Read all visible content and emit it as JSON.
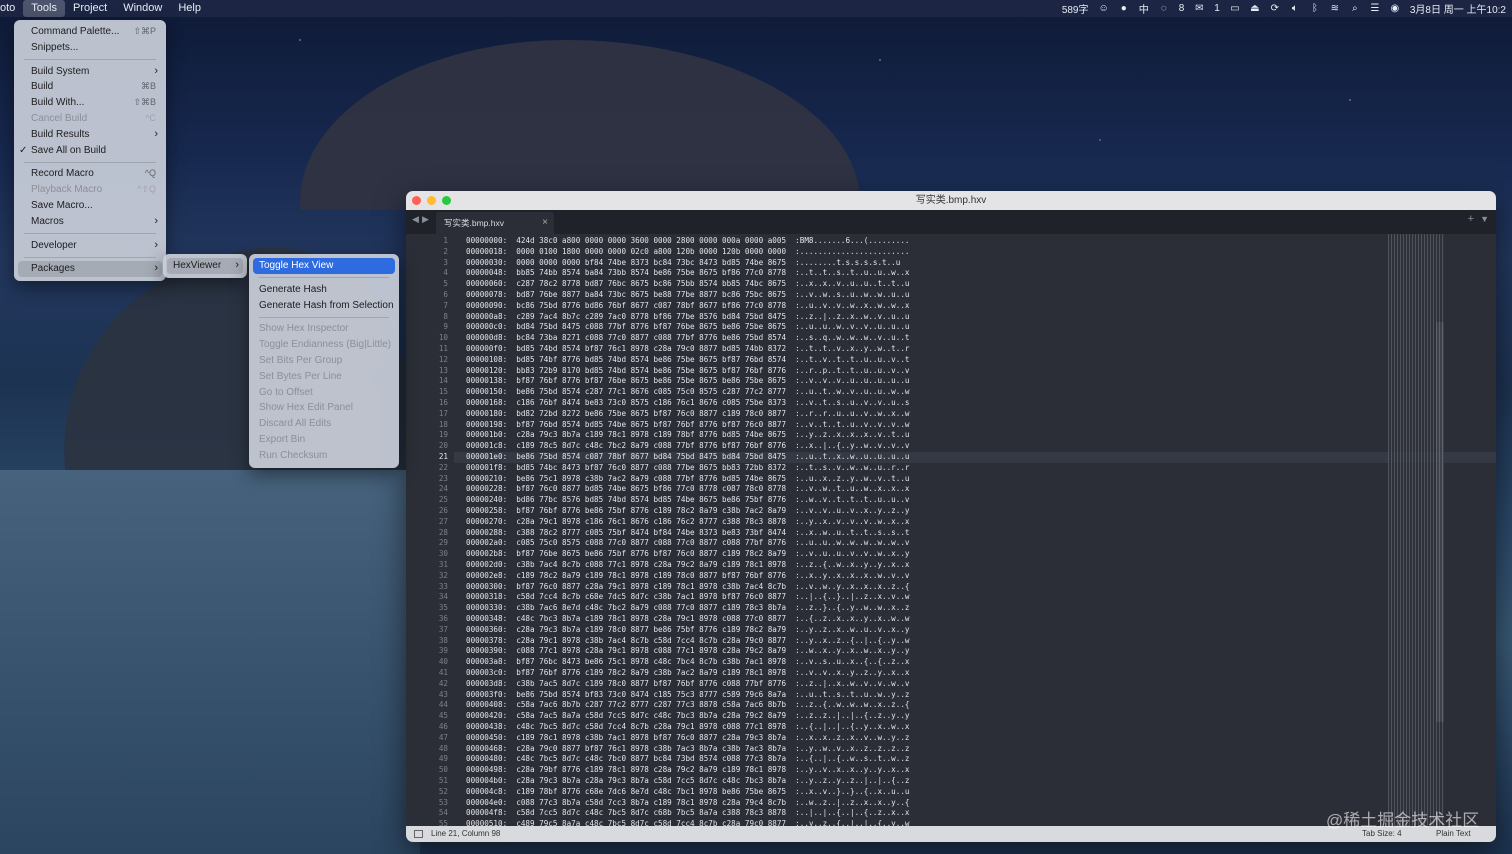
{
  "menubar": {
    "items": [
      "oto",
      "Tools",
      "Project",
      "Window",
      "Help"
    ],
    "right": {
      "word_count": "589字",
      "ime": "中",
      "badge1": "8",
      "wechat_count": "1",
      "datetime": "3月8日 周一 上午10:2"
    }
  },
  "tools_menu": {
    "command_palette": "Command Palette...",
    "command_palette_sc": "⇧⌘P",
    "snippets": "Snippets...",
    "build_system": "Build System",
    "build": "Build",
    "build_sc": "⌘B",
    "build_with": "Build With...",
    "build_with_sc": "⇧⌘B",
    "cancel_build": "Cancel Build",
    "cancel_build_sc": "^C",
    "build_results": "Build Results",
    "save_all_on_build": "Save All on Build",
    "record_macro": "Record Macro",
    "record_macro_sc": "^Q",
    "playback_macro": "Playback Macro",
    "playback_macro_sc": "^⇧Q",
    "save_macro": "Save Macro...",
    "macros": "Macros",
    "developer": "Developer",
    "packages": "Packages"
  },
  "packages_menu": {
    "hexviewer": "HexViewer"
  },
  "hexviewer_menu": {
    "toggle_hex_view": "Toggle Hex View",
    "generate_hash": "Generate Hash",
    "generate_hash_from_selection": "Generate Hash from Selection",
    "show_hex_inspector": "Show Hex Inspector",
    "toggle_endianness": "Toggle Endianness (Big|Little)",
    "set_bits_per_group": "Set Bits Per Group",
    "set_bytes_per_line": "Set Bytes Per Line",
    "go_to_offset": "Go to Offset",
    "show_hex_edit_panel": "Show Hex Edit Panel",
    "discard_all_edits": "Discard All Edits",
    "export_bin": "Export Bin",
    "run_checksum": "Run Checksum"
  },
  "window": {
    "title": "写实类.bmp.hxv",
    "tab_label": "写实类.bmp.hxv",
    "current_line": 21
  },
  "hex_lines": [
    "00000000:  424d 38c0 a800 0000 0000 3600 0000 2800 0000 000a 0000 a005  :BM8.......6...(.........",
    "00000018:  0000 0100 1800 0000 0000 02c0 a800 120b 0000 120b 0000 0000  :........................",
    "00000030:  0000 0000 0000 bf84 74be 8373 bc84 73bc 8473 bd85 74be 8675  :........t.s.s.s.s.t..u",
    "00000048:  bb85 74bb 8574 ba84 73bb 8574 be86 75be 8675 bf86 77c0 8778  :..t..t..s..t..u..u..w..x",
    "00000060:  c287 78c2 8778 bd87 76bc 8675 bc86 75bb 8574 bb85 74bc 8675  :..x..x..v..u..u..t..t..u",
    "00000078:  bd87 76be 8877 ba84 73bc 8675 be88 77be 8877 bc86 75bc 8675  :..v..w..s..u..w..w..u..u",
    "00000090:  bc86 75bd 8776 bd86 76bf 8677 c087 78bf 8677 bf86 77c0 8778  :..u..v..v..w..x..w..w..x",
    "000000a8:  c289 7ac4 8b7c c289 7ac0 8778 bf86 77be 8576 bd84 75bd 8475  :..z..|..z..x..w..v..u..u",
    "000000c0:  bd84 75bd 8475 c088 77bf 8776 bf87 76be 8675 be86 75be 8675  :..u..u..w..v..v..u..u..u",
    "000000d8:  bc84 73ba 8271 c088 77c0 8877 c088 77bf 8776 be86 75bd 8574  :..s..q..w..w..w..v..u..t",
    "000000f0:  bd85 74bd 8574 bf87 76c1 8978 c28a 79c0 8877 bd85 74bb 8372  :..t..t..v..x..y..w..t..r",
    "00000108:  bd85 74bf 8776 bd85 74bd 8574 be86 75be 8675 bf87 76bd 8574  :..t..v..t..t..u..u..v..t",
    "00000120:  bb83 72b9 8170 bd85 74bd 8574 be86 75be 8675 bf87 76bf 8776  :..r..p..t..t..u..u..v..v",
    "00000138:  bf87 76bf 8776 bf87 76be 8675 be86 75be 8675 be86 75be 8675  :..v..v..v..u..u..u..u..u",
    "00000150:  be86 75bd 8574 c287 77c1 8676 c085 75c0 8575 c287 77c2 8777  :..u..t..w..v..u..u..w..w",
    "00000168:  c186 76bf 8474 be83 73c0 8575 c186 76c1 8676 c085 75be 8373  :..v..t..s..u..v..v..u..s",
    "00000180:  bd82 72bd 8272 be86 75be 8675 bf87 76c0 8877 c189 78c0 8877  :..r..r..u..u..v..w..x..w",
    "00000198:  bf87 76bd 8574 bd85 74be 8675 bf87 76bf 8776 bf87 76c0 8877  :..v..t..t..u..v..v..v..w",
    "000001b0:  c28a 79c3 8b7a c189 78c1 8978 c189 78bf 8776 bd85 74be 8675  :..y..z..x..x..x..v..t..u",
    "000001c8:  c189 78c5 8d7c c48c 7bc2 8a79 c088 77bf 8776 bf87 76bf 8776  :..x..|..{..y..w..v..v..v",
    "000001e0:  be86 75bd 8574 c087 78bf 8677 bd84 75bd 8475 bd84 75bd 8475  :..u..t..x..w..u..u..u..u",
    "000001f8:  bd85 74bc 8473 bf87 76c0 8877 c088 77be 8675 bb83 72bb 8372  :..t..s..v..w..w..u..r..r",
    "00000210:  be86 75c1 8978 c38b 7ac2 8a79 c088 77bf 8776 bd85 74be 8675  :..u..x..z..y..w..v..t..u",
    "00000228:  bf87 76c0 8877 bd85 74be 8675 bf86 77c0 8778 c087 78c0 8778  :..v..w..t..u..w..x..x..x",
    "00000240:  bd86 77bc 8576 bd85 74bd 8574 bd85 74be 8675 be86 75bf 8776  :..w..v..t..t..t..u..u..v",
    "00000258:  bf87 76bf 8776 be86 75bf 8776 c189 78c2 8a79 c38b 7ac2 8a79  :..v..v..u..v..x..y..z..y",
    "00000270:  c28a 79c1 8978 c186 76c1 8676 c186 76c2 8777 c388 78c3 8878  :..y..x..v..v..v..w..x..x",
    "00000288:  c388 78c2 8777 c085 75bf 8474 bf84 74be 8373 be83 73bf 8474  :..x..w..u..t..t..s..s..t",
    "000002a0:  c085 75c0 8575 c088 77c0 8877 c088 77c0 8877 c088 77bf 8776  :..u..u..w..w..w..w..w..v",
    "000002b8:  bf87 76be 8675 be86 75bf 8776 bf87 76c0 8877 c189 78c2 8a79  :..v..u..u..v..v..w..x..y",
    "000002d0:  c38b 7ac4 8c7b c088 77c1 8978 c28a 79c2 8a79 c189 78c1 8978  :..z..{..w..x..y..y..x..x",
    "000002e8:  c189 78c2 8a79 c189 78c1 8978 c189 78c0 8877 bf87 76bf 8776  :..x..y..x..x..x..w..v..v",
    "00000300:  bf87 76c0 8877 c28a 79c1 8978 c189 78c1 8978 c38b 7ac4 8c7b  :..v..w..y..x..x..x..z..{",
    "00000318:  c58d 7cc4 8c7b c68e 7dc5 8d7c c38b 7ac1 8978 bf87 76c0 8877  :..|..{..}..|..z..x..v..w",
    "00000330:  c38b 7ac6 8e7d c48c 7bc2 8a79 c088 77c0 8877 c189 78c3 8b7a  :..z..}..{..y..w..w..x..z",
    "00000348:  c48c 7bc3 8b7a c189 78c1 8978 c28a 79c1 8978 c088 77c0 8877  :..{..z..x..x..y..x..w..w",
    "00000360:  c28a 79c3 8b7a c189 78c0 8877 be86 75bf 8776 c189 78c2 8a79  :..y..z..x..w..u..v..x..y",
    "00000378:  c28a 79c1 8978 c38b 7ac4 8c7b c58d 7cc4 8c7b c28a 79c0 8877  :..y..x..z..{..|..{..y..w",
    "00000390:  c088 77c1 8978 c28a 79c1 8978 c088 77c1 8978 c28a 79c2 8a79  :..w..x..y..x..w..x..y..y",
    "000003a8:  bf87 76bc 8473 be86 75c1 8978 c48c 7bc4 8c7b c38b 7ac1 8978  :..v..s..u..x..{..{..z..x",
    "000003c0:  bf87 76bf 8776 c189 78c2 8a79 c38b 7ac2 8a79 c189 78c1 8978  :..v..v..x..y..z..y..x..x",
    "000003d8:  c38b 7ac5 8d7c c189 78c0 8877 bf87 76bf 8776 c088 77bf 8776  :..z..|..x..w..v..v..w..v",
    "000003f0:  be86 75bd 8574 bf83 73c0 8474 c185 75c3 8777 c589 79c6 8a7a  :..u..t..s..t..u..w..y..z",
    "00000408:  c58a 7ac6 8b7b c287 77c2 8777 c287 77c3 8878 c58a 7ac6 8b7b  :..z..{..w..w..w..x..z..{",
    "00000420:  c58a 7ac5 8a7a c58d 7cc5 8d7c c48c 7bc3 8b7a c28a 79c2 8a79  :..z..z..|..|..{..z..y..y",
    "00000438:  c48c 7bc5 8d7c c58d 7cc4 8c7b c28a 79c1 8978 c088 77c1 8978  :..{..|..|..{..y..x..w..x",
    "00000450:  c189 78c1 8978 c38b 7ac1 8978 bf87 76c0 8877 c28a 79c3 8b7a  :..x..x..z..x..v..w..y..z",
    "00000468:  c28a 79c0 8877 bf87 76c1 8978 c38b 7ac3 8b7a c38b 7ac3 8b7a  :..y..w..v..x..z..z..z..z",
    "00000480:  c48c 7bc5 8d7c c48c 7bc0 8877 bc84 73bd 8574 c088 77c3 8b7a  :..{..|..{..w..s..t..w..z",
    "00000498:  c28a 79bf 8776 c189 78c1 8978 c28a 79c2 8a79 c189 78c1 8978  :..y..v..x..x..y..y..x..x",
    "000004b0:  c28a 79c3 8b7a c28a 79c3 8b7a c58d 7cc5 8d7c c48c 7bc3 8b7a  :..y..z..y..z..|..|..{..z",
    "000004c8:  c189 78bf 8776 c68e 7dc6 8e7d c48c 7bc1 8978 be86 75be 8675  :..x..v..}..}..{..x..u..u",
    "000004e0:  c088 77c3 8b7a c58d 7cc3 8b7a c189 78c1 8978 c28a 79c4 8c7b  :..w..z..|..z..x..x..y..{",
    "000004f8:  c58d 7cc5 8d7c c48c 7bc5 8d7c c68b 7bc5 8a7a c388 78c3 8878  :..|..|..{..|..{..z..x..x",
    "00000510:  c489 79c5 8a7a c48c 7bc5 8d7c c58d 7cc4 8c7b c28a 79c0 8877  :..y..z..{..|..|..{..y..w"
  ],
  "statusbar": {
    "position": "Line 21, Column 98",
    "tab_size": "Tab Size: 4",
    "syntax": "Plain Text"
  },
  "watermark": "@稀土掘金技术社区"
}
